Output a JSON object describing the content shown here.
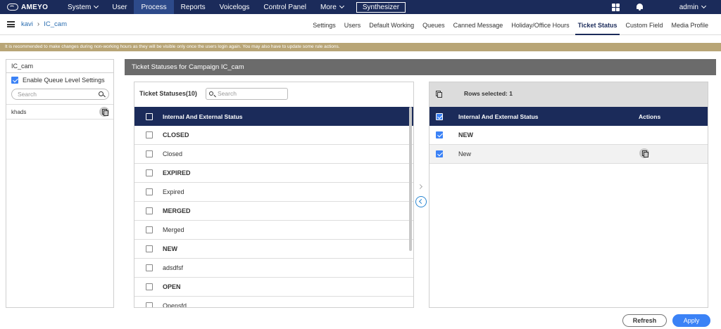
{
  "topnav": {
    "logo_text": "AMEYO",
    "items": [
      {
        "label": "System",
        "dropdown": true
      },
      {
        "label": "User",
        "dropdown": false
      },
      {
        "label": "Process",
        "dropdown": false,
        "active": true
      },
      {
        "label": "Reports",
        "dropdown": false
      },
      {
        "label": "Voicelogs",
        "dropdown": false
      },
      {
        "label": "Control Panel",
        "dropdown": false
      },
      {
        "label": "More",
        "dropdown": true
      }
    ],
    "synthesizer_label": "Synthesizer",
    "user_label": "admin",
    "icons": [
      "apps-grid-icon",
      "bell-icon"
    ]
  },
  "breadcrumb": {
    "items": [
      "kavi",
      "IC_cam"
    ]
  },
  "tabs": [
    {
      "label": "Settings"
    },
    {
      "label": "Users"
    },
    {
      "label": "Default Working"
    },
    {
      "label": "Queues"
    },
    {
      "label": "Canned Message"
    },
    {
      "label": "Holiday/Office Hours"
    },
    {
      "label": "Ticket Status",
      "active": true
    },
    {
      "label": "Custom Field"
    },
    {
      "label": "Media Profile"
    }
  ],
  "warning": "It is recommended to make changes during non-working hours as they will be visible only once the users login again. You may also have to update some rule actions.",
  "left_panel": {
    "title": "IC_cam",
    "enable_queue_label": "Enable Queue Level Settings",
    "enable_queue_checked": true,
    "search_placeholder": "Search",
    "queues": [
      {
        "name": "khads"
      }
    ]
  },
  "main": {
    "title": "Ticket Statuses for Campaign IC_cam",
    "available": {
      "title": "Ticket Statuses(10)",
      "search_placeholder": "Search",
      "column_header": "Internal And External Status",
      "rows": [
        {
          "label": "CLOSED",
          "bold": true
        },
        {
          "label": "Closed",
          "bold": false
        },
        {
          "label": "EXPIRED",
          "bold": true
        },
        {
          "label": "Expired",
          "bold": false
        },
        {
          "label": "MERGED",
          "bold": true
        },
        {
          "label": "Merged",
          "bold": false
        },
        {
          "label": "NEW",
          "bold": true
        },
        {
          "label": "adsdfsf",
          "bold": false
        },
        {
          "label": "OPEN",
          "bold": true
        },
        {
          "label": "Opensfd",
          "bold": false
        }
      ]
    },
    "selected": {
      "rows_selected_label": "Rows selected: 1",
      "column_header": "Internal And External Status",
      "actions_header": "Actions",
      "rows": [
        {
          "label": "NEW",
          "bold": true,
          "checked": true
        },
        {
          "label": "New",
          "bold": false,
          "checked": true,
          "has_action": true
        }
      ]
    }
  },
  "buttons": {
    "refresh": "Refresh",
    "apply": "Apply"
  },
  "colors": {
    "nav_bg": "#1b2b5a",
    "nav_active": "#2d4a8a",
    "warning_bg": "#b8a576",
    "panel_header_bg": "#6b6b6b",
    "accent": "#3b82f6"
  }
}
